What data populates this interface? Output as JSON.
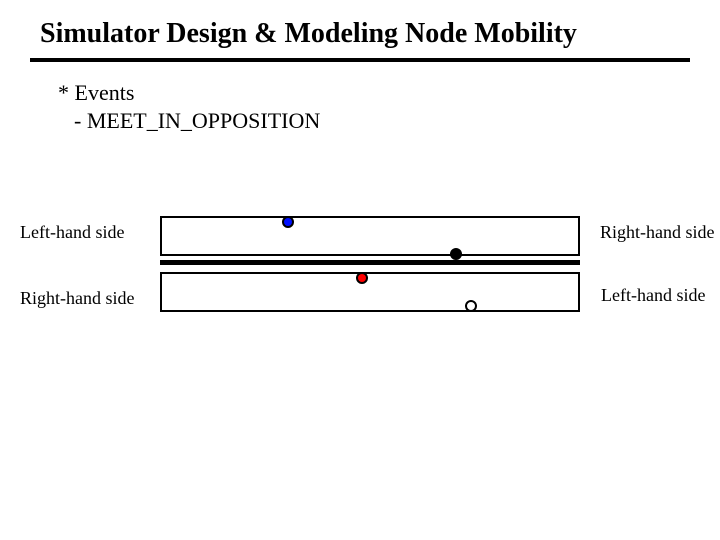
{
  "title": "Simulator Design & Modeling Node Mobility",
  "bullets": {
    "b1": "* Events",
    "b2": "- MEET_IN_OPPOSITION"
  },
  "labels": {
    "top_left": "Left-hand side",
    "top_right": "Right-hand side",
    "bottom_left": "Right-hand side",
    "bottom_right": "Left-hand side"
  },
  "nodes": {
    "blue": {
      "color": "#0010ff",
      "role": "node-blue"
    },
    "black": {
      "color": "#000000",
      "role": "node-black-top"
    },
    "red": {
      "color": "#ff0000",
      "role": "node-red"
    },
    "hollow": {
      "color": "#ffffff",
      "role": "node-hollow-bottom"
    }
  }
}
